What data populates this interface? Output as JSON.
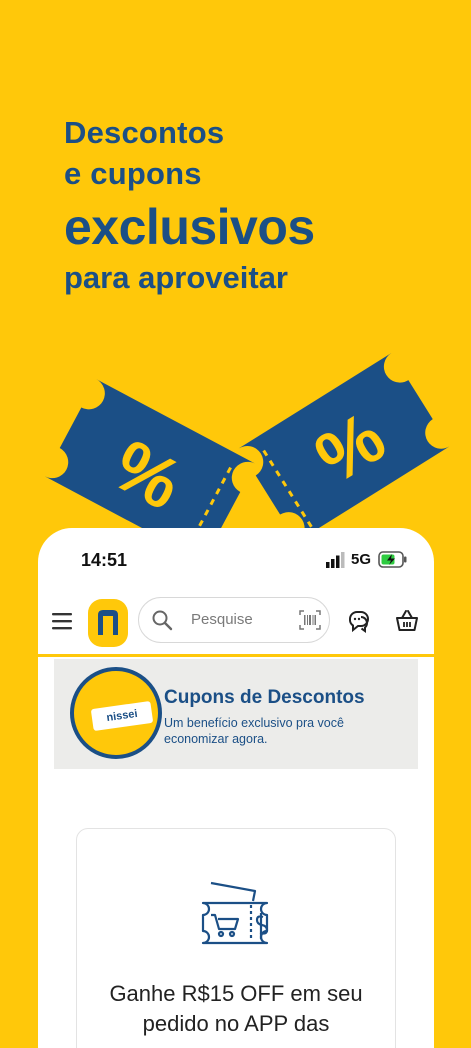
{
  "promo": {
    "line1": "Descontos",
    "line2": "e cupons",
    "line3": "exclusivos",
    "line4": "para aproveitar",
    "ticket_symbol": "%"
  },
  "colors": {
    "background": "#FFC80A",
    "brand_blue": "#1B4F86",
    "battery_green": "#2ECC40"
  },
  "status_bar": {
    "time": "14:51",
    "network": "5G"
  },
  "app_bar": {
    "search_placeholder": "Pesquise"
  },
  "banner": {
    "brand": "nissei",
    "title": "Cupons de Descontos",
    "subtitle": "Um benefício exclusivo pra você economizar agora."
  },
  "coupon_card": {
    "text": "Ganhe R$15 OFF em seu pedido no APP das"
  },
  "icons": [
    "menu-icon",
    "logo-icon",
    "search-icon",
    "barcode-icon",
    "chat-icon",
    "basket-icon",
    "coupon-cart-icon"
  ]
}
